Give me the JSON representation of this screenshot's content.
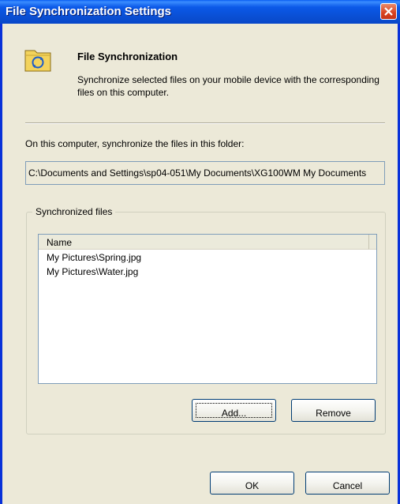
{
  "window": {
    "title": "File Synchronization Settings"
  },
  "header": {
    "heading": "File Synchronization",
    "description": "Synchronize selected files on your mobile device with the corresponding files on this computer."
  },
  "folder": {
    "label": "On this computer, synchronize the files in this folder:",
    "path": "C:\\Documents and Settings\\sp04-051\\My Documents\\XG100WM My Documents"
  },
  "synced_files": {
    "group_label": "Synchronized files",
    "column_header": "Name",
    "rows": [
      "My Pictures\\Spring.jpg",
      "My Pictures\\Water.jpg"
    ]
  },
  "buttons": {
    "add": "Add...",
    "remove": "Remove",
    "ok": "OK",
    "cancel": "Cancel"
  }
}
